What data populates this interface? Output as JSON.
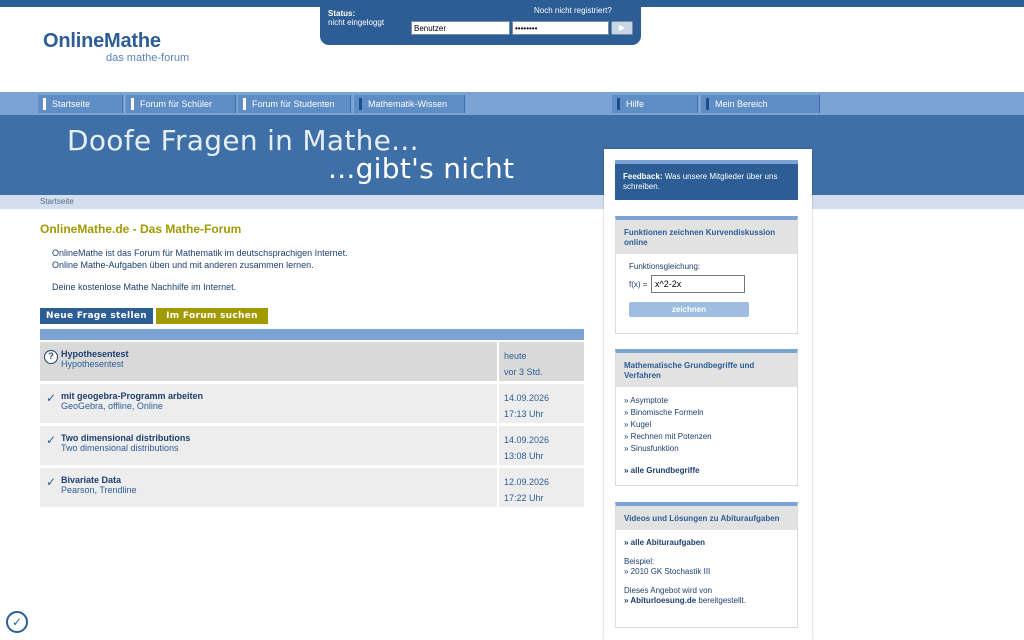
{
  "login": {
    "status_label": "Status:",
    "status_value": "nicht eingeloggt",
    "register_link": "Noch nicht registriert?",
    "username_value": "Benutzer",
    "password_value": "••••••••",
    "go_icon": "play-arrow-icon"
  },
  "logo": {
    "title": "OnlineMathe",
    "subtitle": "das mathe-forum"
  },
  "nav": {
    "items": [
      {
        "label": "Startseite"
      },
      {
        "label": "Forum für Schüler"
      },
      {
        "label": "Forum für Studenten"
      },
      {
        "label": "Mathematik-Wissen"
      },
      {
        "label": "Hilfe"
      },
      {
        "label": "Mein Bereich"
      }
    ]
  },
  "banner": {
    "line1": "Doofe Fragen in Mathe...",
    "line2": "...gibt's nicht"
  },
  "breadcrumb": "Startseite",
  "main": {
    "title": "OnlineMathe.de - Das Mathe-Forum",
    "intro_line1": "OnlineMathe ist das Forum für Mathematik im deutschsprachigen Internet.",
    "intro_line2": "Online Mathe-Aufgaben üben und mit anderen zusammen lernen.",
    "intro_line3": "Deine kostenlose Mathe Nachhilfe im Internet.",
    "ask_button": "Neue Frage stellen",
    "search_button": "Im Forum suchen"
  },
  "threads": [
    {
      "icon": "question-icon",
      "title": "Hypothesentest",
      "subtitle": "Hypothesentest",
      "date": "heute",
      "time": "vor 3 Std."
    },
    {
      "icon": "check-icon",
      "title": "mit geogebra-Programm arbeiten",
      "subtitle": "GeoGebra, offline, Online",
      "date": "14.09.2026",
      "time": "17:13 Uhr"
    },
    {
      "icon": "check-icon",
      "title": "Two dimensional distributions",
      "subtitle": "Two dimensional distributions",
      "date": "14.09.2026",
      "time": "13:08 Uhr"
    },
    {
      "icon": "check-icon",
      "title": "Bivariate Data",
      "subtitle": "Pearson, Trendline",
      "date": "12.09.2026",
      "time": "17:22 Uhr"
    }
  ],
  "sidebar": {
    "feedback_bold": "Feedback:",
    "feedback_text": " Was unsere Mitglieder über uns schreiben.",
    "plot": {
      "heading": "Funktionen zeichnen Kurvendiskussion online",
      "label": "Funktionsgleichung:",
      "fx": "f(x) =",
      "input_value": "x^2-2x",
      "button": "zeichnen"
    },
    "basics": {
      "heading": "Mathematische Grundbegriffe und Verfahren",
      "items": [
        "» Asymptote",
        "» Binomische Formeln",
        "» Kugel",
        "» Rechnen mit Potenzen",
        "» Sinusfunktion"
      ],
      "all_link": "» alle Grundbegriffe"
    },
    "abitur": {
      "heading": "Videos und Lösungen zu Abituraufgaben",
      "all_link": "» alle Abituraufgaben",
      "example_label": "Beispiel:",
      "example_item": "» 2010 GK Stochastik III",
      "offer_line1": "Dieses Angebot wird von",
      "offer_link": "» Abiturloesung.de",
      "offer_suffix": " bereitgestellt."
    }
  },
  "colors": {
    "brand_blue": "#2c5d95",
    "nav_blue": "#7ba3d3",
    "accent_olive": "#a19a00"
  }
}
